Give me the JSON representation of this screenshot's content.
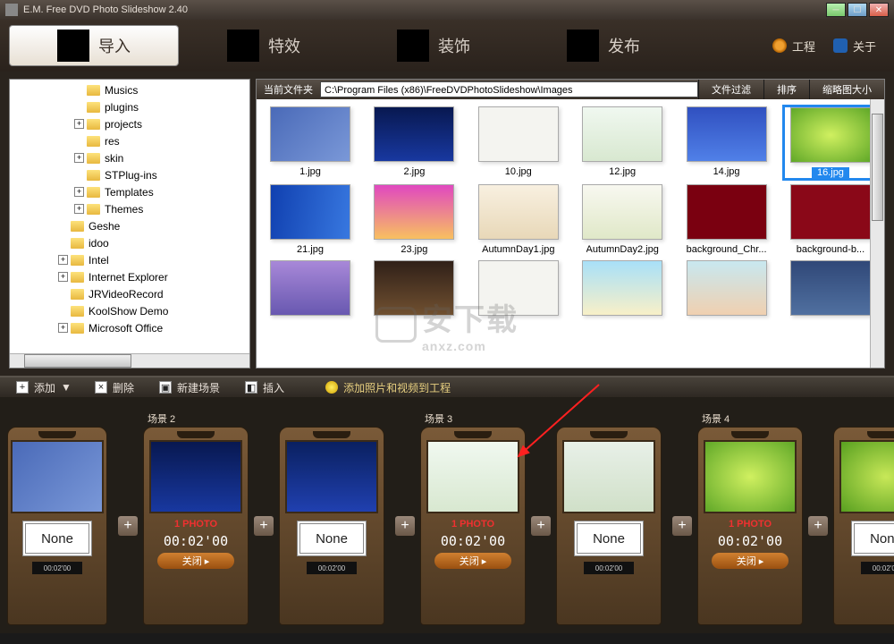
{
  "title": "E.M. Free DVD Photo Slideshow 2.40",
  "main_tabs": {
    "import": "导入",
    "effect": "特效",
    "decorate": "装饰",
    "publish": "发布"
  },
  "right_buttons": {
    "project": "工程",
    "about": "关于"
  },
  "tree": [
    {
      "label": "Musics",
      "exp": ""
    },
    {
      "label": "plugins",
      "exp": ""
    },
    {
      "label": "projects",
      "exp": "+"
    },
    {
      "label": "res",
      "exp": ""
    },
    {
      "label": "skin",
      "exp": "+"
    },
    {
      "label": "STPlug-ins",
      "exp": ""
    },
    {
      "label": "Templates",
      "exp": "+"
    },
    {
      "label": "Themes",
      "exp": "+"
    },
    {
      "label": "Geshe",
      "exp": "",
      "level": 1
    },
    {
      "label": "idoo",
      "exp": "",
      "level": 1
    },
    {
      "label": "Intel",
      "exp": "+",
      "level": 1
    },
    {
      "label": "Internet Explorer",
      "exp": "+",
      "level": 1
    },
    {
      "label": "JRVideoRecord",
      "exp": "",
      "level": 1
    },
    {
      "label": "KoolShow Demo",
      "exp": "",
      "level": 1
    },
    {
      "label": "Microsoft Office",
      "exp": "+",
      "level": 1
    }
  ],
  "browser": {
    "folder_label": "当前文件夹",
    "path": "C:\\Program Files (x86)\\FreeDVDPhotoSlideshow\\Images",
    "btn_filter": "文件过滤",
    "btn_sort": "排序",
    "btn_size": "缩略图大小",
    "row1": [
      {
        "name": "1.jpg",
        "bg": "linear-gradient(135deg,#4a6ab8,#7a98d8)"
      },
      {
        "name": "2.jpg",
        "bg": "linear-gradient(#081850,#1838a0)"
      },
      {
        "name": "10.jpg",
        "bg": "#f4f4f0"
      },
      {
        "name": "12.jpg",
        "bg": "linear-gradient(#f0f8f0,#d8e8d0)"
      },
      {
        "name": "14.jpg",
        "bg": "linear-gradient(#3050c0,#5080e8)"
      },
      {
        "name": "16.jpg",
        "bg": "radial-gradient(#d0f060,#60a828)",
        "selected": true
      }
    ],
    "row2": [
      {
        "name": "21.jpg",
        "bg": "linear-gradient(100deg,#1040b0,#3878e0)"
      },
      {
        "name": "23.jpg",
        "bg": "linear-gradient(#e048c0,#f8c060)"
      },
      {
        "name": "AutumnDay1.jpg",
        "bg": "linear-gradient(#f8f0e0,#e8d8b8)"
      },
      {
        "name": "AutumnDay2.jpg",
        "bg": "linear-gradient(#f8f8f0,#e0e8c8)"
      },
      {
        "name": "background_Chr...",
        "bg": "#7a0010"
      },
      {
        "name": "background-b...",
        "bg": "#8a0818"
      }
    ],
    "row3": [
      {
        "name": "",
        "bg": "linear-gradient(#a888d8,#6858b0)"
      },
      {
        "name": "",
        "bg": "linear-gradient(#302018,#705030)"
      },
      {
        "name": "",
        "bg": "#f4f4f0"
      },
      {
        "name": "",
        "bg": "linear-gradient(#a8e0f8,#f8f0c8)"
      },
      {
        "name": "",
        "bg": "linear-gradient(#c8e8f0,#f0d0b0)"
      },
      {
        "name": "",
        "bg": "linear-gradient(#304878,#5070a0)"
      }
    ]
  },
  "toolbar": {
    "add": "添加",
    "delete": "删除",
    "new_scene": "新建场景",
    "insert": "插入",
    "hint": "添加照片和视频到工程"
  },
  "timeline": {
    "none": "None",
    "photo": "1 PHOTO",
    "time": "00:02'00",
    "close": "关闭",
    "scenes": [
      {
        "title": "",
        "bg": "linear-gradient(135deg,#4a6ab8,#7a98d8)",
        "type": "trans"
      },
      {
        "title": "场景 2",
        "bg1": "linear-gradient(#081850,#1838a0)",
        "bg2": "linear-gradient(#0a2060,#2040b0)"
      },
      {
        "title": "场景 3",
        "bg1": "linear-gradient(#f0f8f0,#d8e8d0)",
        "bg2": "linear-gradient(#e8f0e8,#d0e0c8)"
      },
      {
        "title": "场景 4",
        "bg1": "radial-gradient(#d0f060,#60a828)",
        "bg2": "radial-gradient(#c8e858,#58a020)"
      }
    ]
  },
  "watermark": "安下载",
  "watermark_sub": "anxz.com"
}
